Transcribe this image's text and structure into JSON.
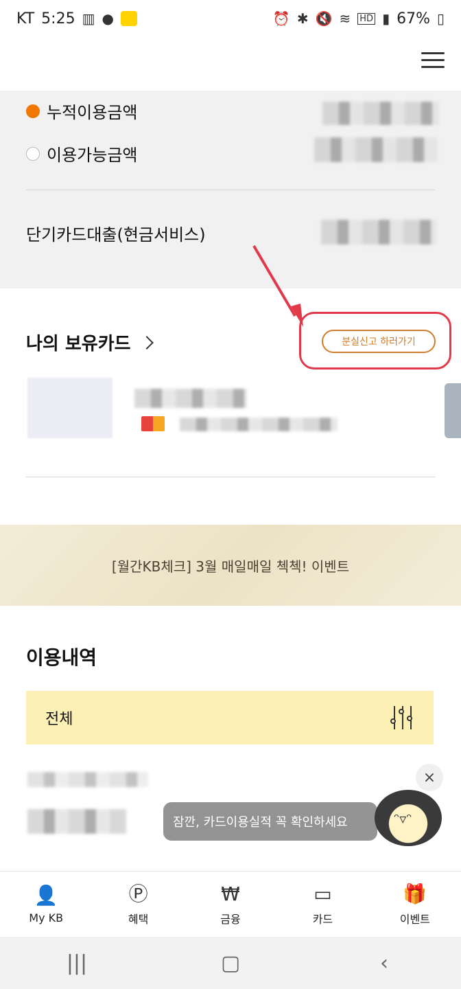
{
  "status_bar": {
    "carrier": "KT",
    "time": "5:25",
    "battery": "67%",
    "hd": "HD"
  },
  "summary": {
    "accumulated_label": "누적이용금액",
    "available_label": "이용가능금액",
    "loan_label": "단기카드대출(현금서비스)"
  },
  "cards": {
    "title": "나의 보유카드",
    "loss_button": "분실신고 하러가기"
  },
  "banner": {
    "text": "[월간KB체크] 3월 매일매일 첵첵! 이벤트"
  },
  "usage": {
    "title": "이용내역",
    "filter_label": "전체"
  },
  "toast": {
    "text": "잠깐, 카드이용실적 꼭 확인하세요",
    "close": "×"
  },
  "bottom_nav": [
    {
      "label": "My KB",
      "icon": "person-icon"
    },
    {
      "label": "혜택",
      "icon": "benefit-bag-icon"
    },
    {
      "label": "금융",
      "icon": "finance-won-icon"
    },
    {
      "label": "카드",
      "icon": "card-icon"
    },
    {
      "label": "이벤트",
      "icon": "gift-icon"
    }
  ],
  "colors": {
    "accent_orange": "#f07800",
    "highlight_red": "#e03a4a",
    "banner_bg": "#f1e8cf",
    "filter_bg": "#fdf0b5"
  }
}
